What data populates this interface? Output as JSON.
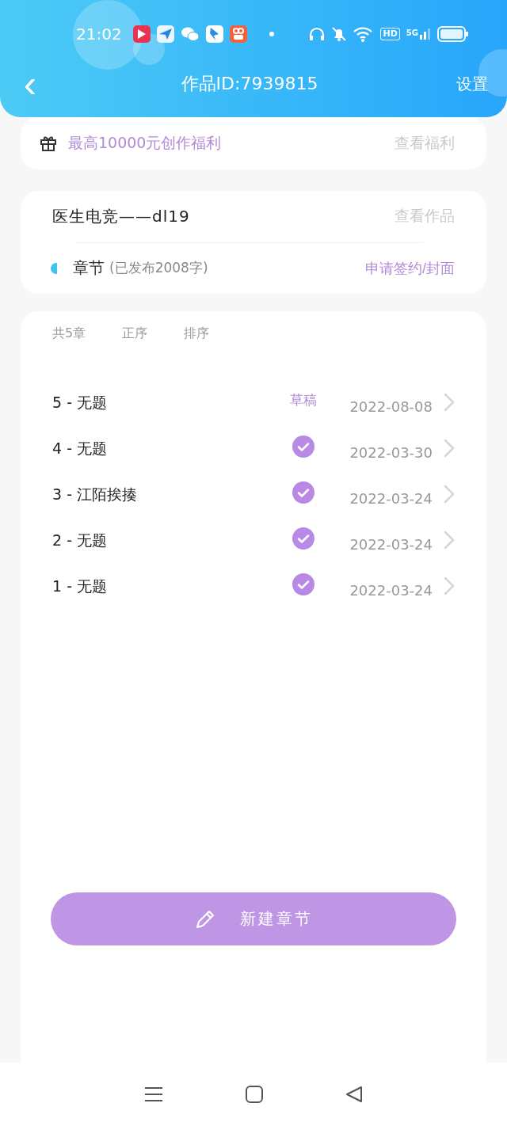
{
  "status_bar": {
    "time": "21:02",
    "network_badges": [
      "HD",
      "5G"
    ]
  },
  "header": {
    "back": "‹",
    "title": "作品ID:7939815",
    "action": "设置"
  },
  "promo": {
    "text": "最高10000元创作福利",
    "link": "查看福利"
  },
  "work": {
    "title": "医生电竞——dl19",
    "link": "查看作品",
    "section": "章节",
    "section_note": "(已发布2008字)",
    "action": "申请签约/封面"
  },
  "chapters": {
    "toolbar": [
      "共5章",
      "正序",
      "排序"
    ],
    "items": [
      {
        "title": "5 - 无题",
        "kind": "draft",
        "status": "草稿",
        "date": "2022-08-08"
      },
      {
        "title": "4 - 无题",
        "kind": "published",
        "date": "2022-03-30"
      },
      {
        "title": "3 - 江陌挨揍",
        "kind": "published",
        "date": "2022-03-24"
      },
      {
        "title": "2 - 无题",
        "kind": "published",
        "date": "2022-03-24"
      },
      {
        "title": "1 - 无题",
        "kind": "published",
        "date": "2022-03-24"
      }
    ],
    "new_button": "新建章节"
  }
}
